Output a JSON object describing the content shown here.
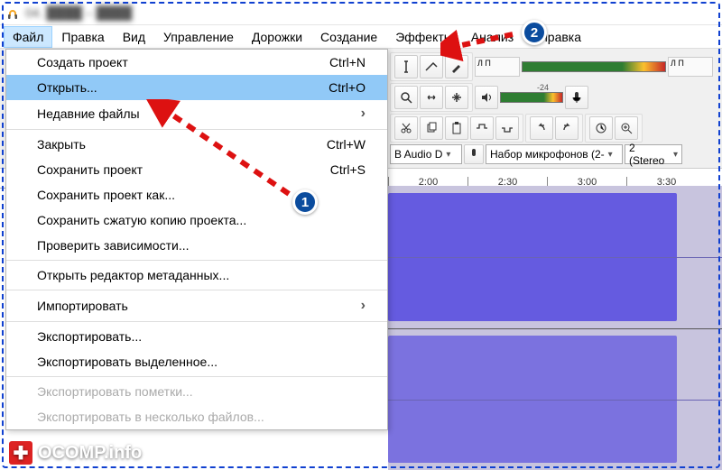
{
  "title": "04. ████ – ████",
  "menubar": [
    "Файл",
    "Правка",
    "Вид",
    "Управление",
    "Дорожки",
    "Создание",
    "Эффекты",
    "Анализ",
    "Справка"
  ],
  "dropdown": {
    "items": [
      {
        "label": "Создать проект",
        "shortcut": "Ctrl+N"
      },
      {
        "label": "Открыть...",
        "shortcut": "Ctrl+O",
        "hover": true
      },
      {
        "label": "Недавние файлы",
        "submenu": true
      },
      {
        "sep": true
      },
      {
        "label": "Закрыть",
        "shortcut": "Ctrl+W"
      },
      {
        "label": "Сохранить проект",
        "shortcut": "Ctrl+S"
      },
      {
        "label": "Сохранить проект как..."
      },
      {
        "label": "Сохранить сжатую копию проекта..."
      },
      {
        "label": "Проверить зависимости..."
      },
      {
        "sep": true
      },
      {
        "label": "Открыть редактор метаданных..."
      },
      {
        "sep": true
      },
      {
        "label": "Импортировать",
        "submenu": true
      },
      {
        "sep": true
      },
      {
        "label": "Экспортировать..."
      },
      {
        "label": "Экспортировать выделенное..."
      },
      {
        "sep": true
      },
      {
        "label": "Экспортировать пометки...",
        "disabled": true
      },
      {
        "label": "Экспортировать в несколько файлов...",
        "disabled": true
      }
    ]
  },
  "toolbar": {
    "meter_lp": "Л\nП",
    "meter_value": "-24",
    "host_combo": "B Audio D",
    "mic_combo": "Набор микрофонов (2-",
    "chan_combo": "2 (Stereo"
  },
  "timeline": [
    "2:00",
    "2:30",
    "3:00",
    "3:30"
  ],
  "annotations": {
    "1": "1",
    "2": "2"
  },
  "watermark": "OCOMP.info"
}
